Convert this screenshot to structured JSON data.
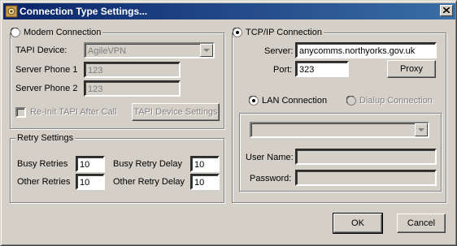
{
  "window": {
    "title": "Connection Type Settings...",
    "icon": "gear-app-icon",
    "close_icon": "close-icon"
  },
  "modem": {
    "legend": "Modem Connection",
    "selected": false,
    "tapi_device_label": "TAPI Device:",
    "tapi_device_value": "AgileVPN",
    "server_phone1_label": "Server Phone 1",
    "server_phone1_value": "123",
    "server_phone2_label": "Server Phone 2",
    "server_phone2_value": "123",
    "reinit_label": "Re-Init TAPI After Call",
    "reinit_checked": false,
    "tapi_settings_button": "TAPI Device Settings"
  },
  "retry": {
    "legend": "Retry Settings",
    "busy_retries_label": "Busy Retries",
    "busy_retries_value": "10",
    "busy_delay_label": "Busy Retry Delay",
    "busy_delay_value": "10",
    "other_retries_label": "Other Retries",
    "other_retries_value": "10",
    "other_delay_label": "Other Retry Delay",
    "other_delay_value": "10"
  },
  "tcpip": {
    "legend": "TCP/IP Connection",
    "selected": true,
    "server_label": "Server:",
    "server_value": "anycomms.northyorks.gov.uk",
    "port_label": "Port:",
    "port_value": "323",
    "proxy_button": "Proxy",
    "lan_label": "LAN Connection",
    "lan_selected": true,
    "dialup_label": "Dialup Connection",
    "dialup_selected": false,
    "dialup_combo_value": "",
    "username_label": "User Name:",
    "username_value": "",
    "password_label": "Password:",
    "password_value": ""
  },
  "buttons": {
    "ok": "OK",
    "cancel": "Cancel"
  }
}
